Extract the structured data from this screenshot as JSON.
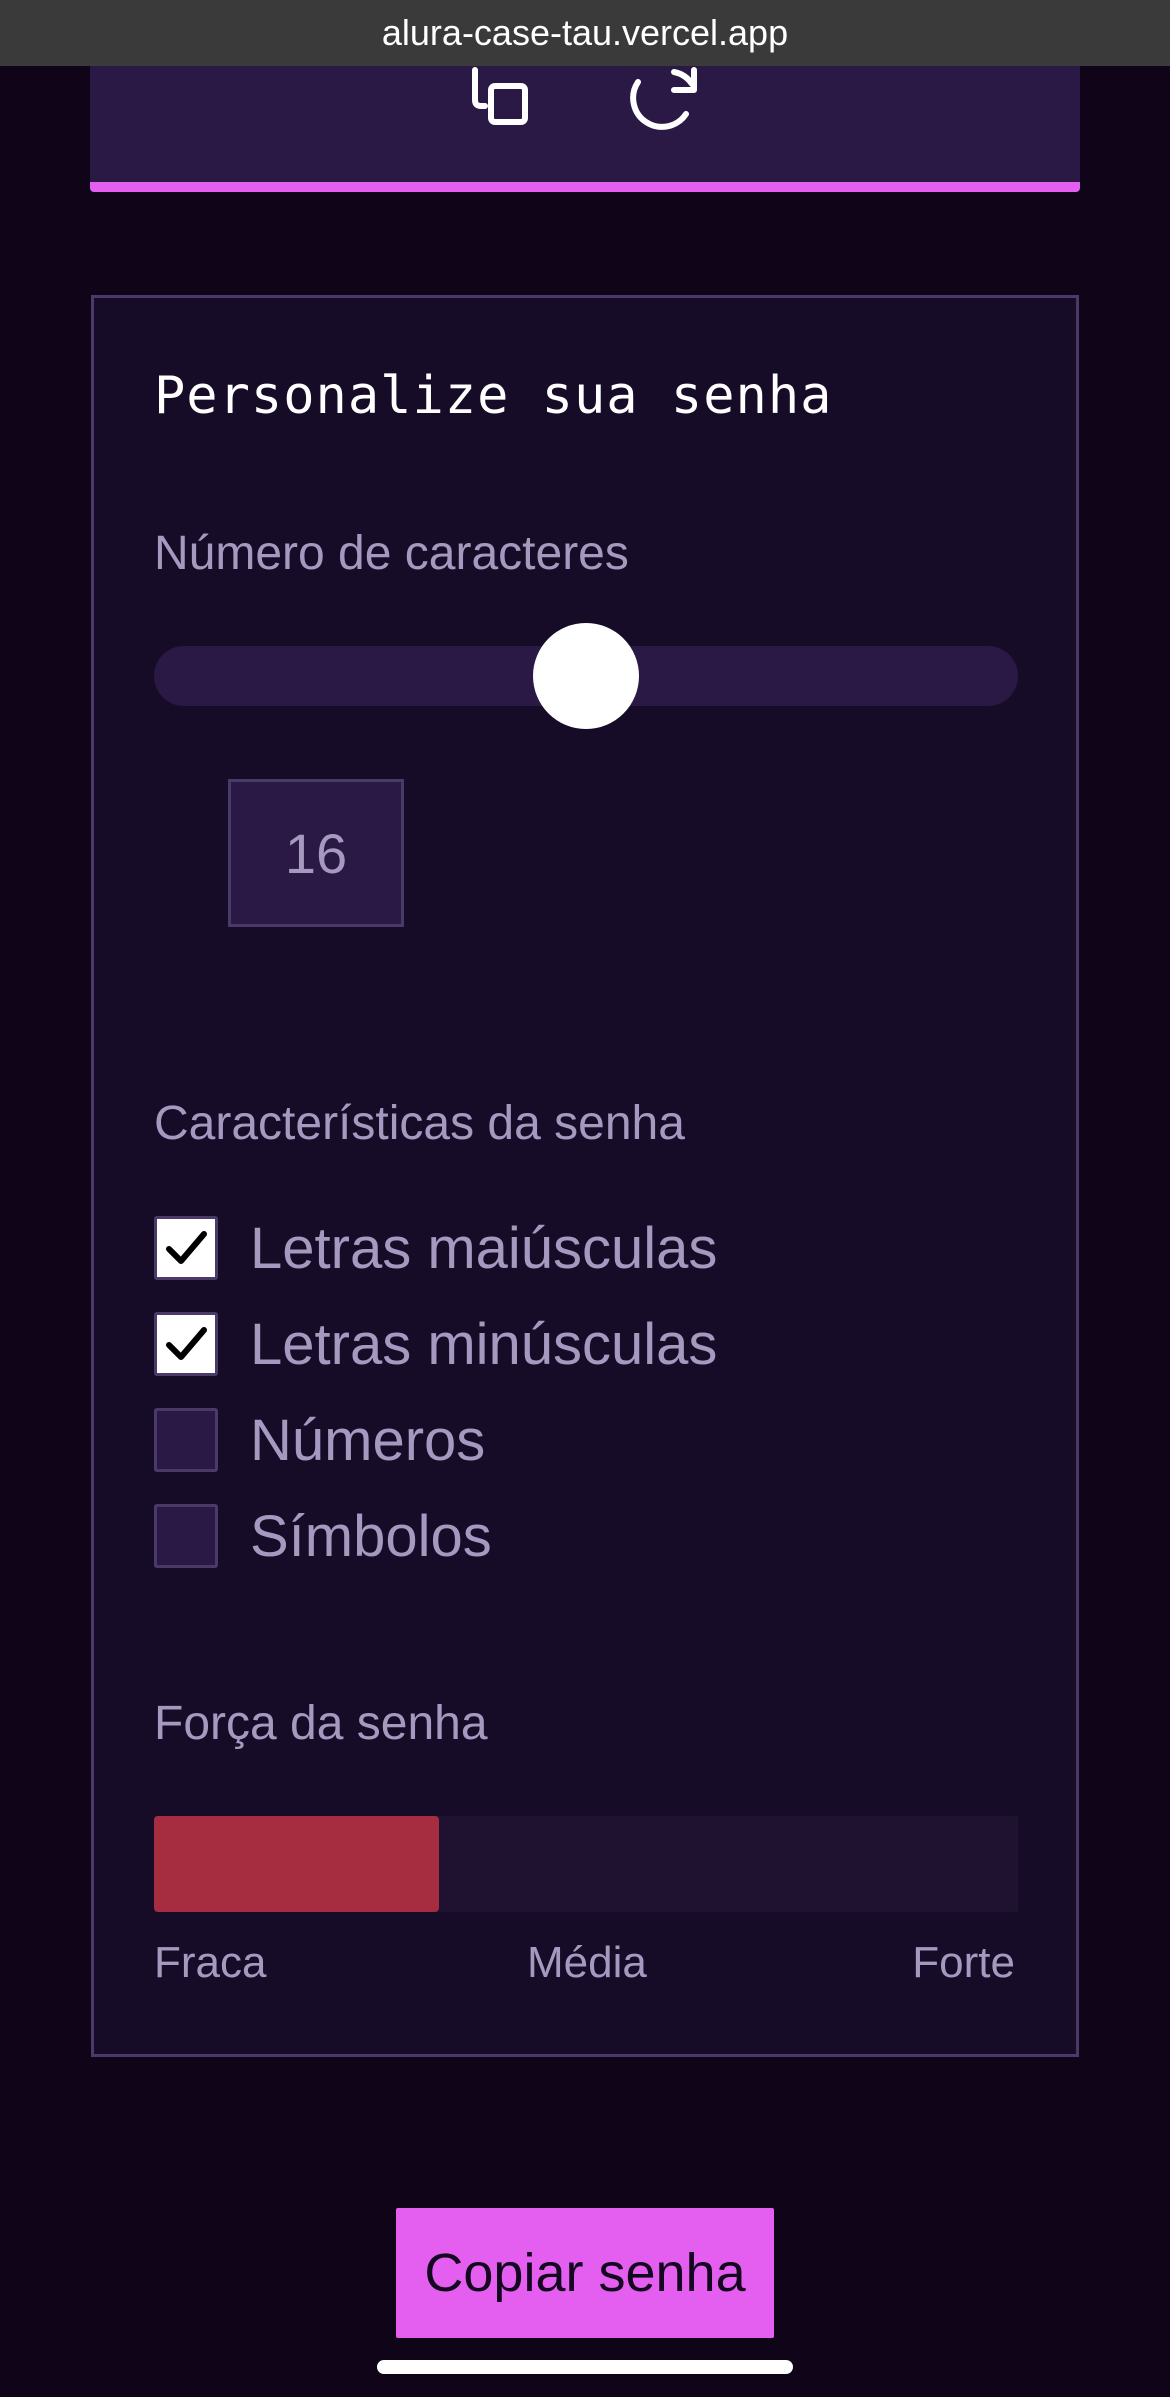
{
  "browser": {
    "url": "alura-case-tau.vercel.app"
  },
  "generator": {
    "copy_icon": "copy-icon",
    "refresh_icon": "refresh-icon"
  },
  "customize": {
    "title": "Personalize sua senha",
    "length_label": "Número de caracteres",
    "length_value": "16",
    "length_slider_fraction": 0.5,
    "features_label": "Características da senha",
    "options": [
      {
        "label": "Letras maiúsculas",
        "checked": true
      },
      {
        "label": "Letras minúsculas",
        "checked": true
      },
      {
        "label": "Números",
        "checked": false
      },
      {
        "label": "Símbolos",
        "checked": false
      }
    ],
    "strength_label": "Força da senha",
    "strength_fraction": 0.33,
    "strength_color": "#a62c3f",
    "strength_levels": [
      "Fraca",
      "Média",
      "Forte"
    ]
  },
  "copy_button_label": "Copiar senha",
  "colors": {
    "accent": "#e45ef0",
    "background": "#0f0418",
    "panel": "#170c28"
  }
}
